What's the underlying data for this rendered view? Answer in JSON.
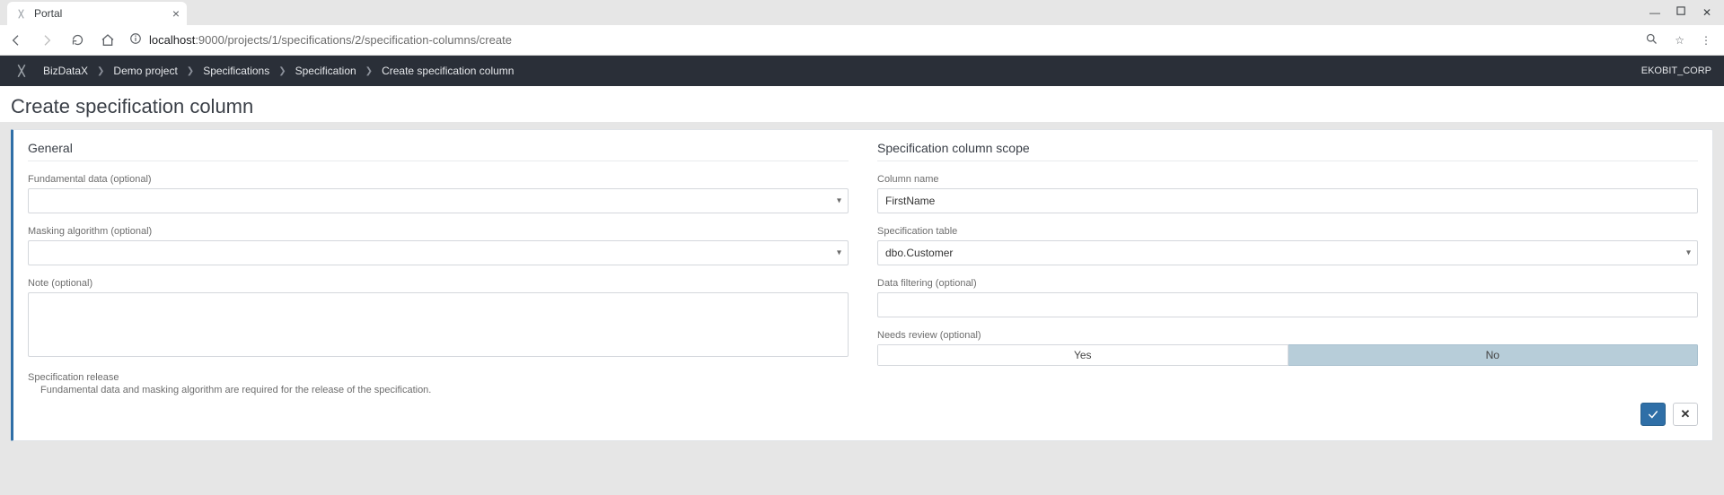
{
  "browser": {
    "tab_title": "Portal",
    "url_host": "localhost",
    "url_port_path": ":9000/projects/1/specifications/2/specification-columns/create"
  },
  "nav": {
    "brand": "BizDataX",
    "crumbs": [
      "Demo project",
      "Specifications",
      "Specification",
      "Create specification column"
    ],
    "tenant": "EKOBIT_CORP"
  },
  "page": {
    "title": "Create specification column"
  },
  "general": {
    "section_title": "General",
    "fundamental_label": "Fundamental data (optional)",
    "fundamental_value": "",
    "masking_label": "Masking algorithm (optional)",
    "masking_value": "",
    "note_label": "Note (optional)",
    "note_value": "",
    "release_head": "Specification release",
    "release_body": "Fundamental data and masking algorithm are required for the release of the specification."
  },
  "scope": {
    "section_title": "Specification column scope",
    "column_name_label": "Column name",
    "column_name_value": "FirstName",
    "spec_table_label": "Specification table",
    "spec_table_value": "dbo.Customer",
    "data_filtering_label": "Data filtering (optional)",
    "data_filtering_value": "",
    "needs_review_label": "Needs review (optional)",
    "needs_review_yes": "Yes",
    "needs_review_no": "No",
    "needs_review_selected": "No"
  },
  "actions": {
    "confirm": "✓",
    "cancel": "✕"
  }
}
